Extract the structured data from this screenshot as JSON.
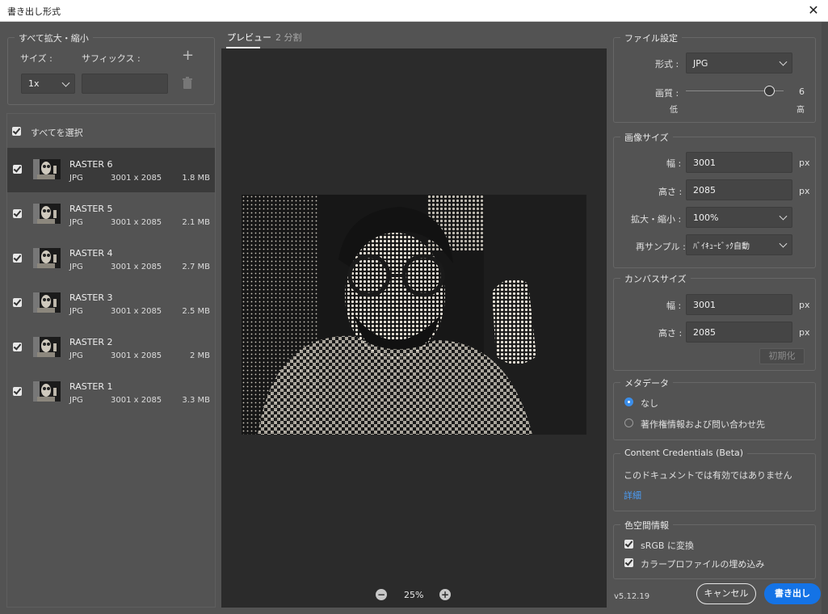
{
  "window": {
    "title": "書き出し形式"
  },
  "scale_group": {
    "legend": "すべて拡大・縮小",
    "size_label": "サイズ :",
    "suffix_label": "サフィックス :",
    "size_value": "1x",
    "suffix_value": ""
  },
  "assets": {
    "select_all_label": "すべてを選択",
    "items": [
      {
        "name": "RASTER 6",
        "format": "JPG",
        "dimensions": "3001 x 2085",
        "size": "1.8 MB",
        "selected": true
      },
      {
        "name": "RASTER 5",
        "format": "JPG",
        "dimensions": "3001 x 2085",
        "size": "2.1 MB",
        "selected": false
      },
      {
        "name": "RASTER 4",
        "format": "JPG",
        "dimensions": "3001 x 2085",
        "size": "2.7 MB",
        "selected": false
      },
      {
        "name": "RASTER 3",
        "format": "JPG",
        "dimensions": "3001 x 2085",
        "size": "2.5 MB",
        "selected": false
      },
      {
        "name": "RASTER 2",
        "format": "JPG",
        "dimensions": "3001 x 2085",
        "size": "2 MB",
        "selected": false
      },
      {
        "name": "RASTER 1",
        "format": "JPG",
        "dimensions": "3001 x 2085",
        "size": "3.3 MB",
        "selected": false
      }
    ]
  },
  "preview": {
    "tabs": [
      {
        "label": "プレビュー",
        "active": true
      },
      {
        "label": "2 分割",
        "active": false
      }
    ],
    "zoom": "25%"
  },
  "file_settings": {
    "legend": "ファイル設定",
    "format_label": "形式 :",
    "format_value": "JPG",
    "quality_label": "画質 :",
    "quality_value": "6",
    "quality_fraction": 0.86,
    "quality_low": "低",
    "quality_high": "高"
  },
  "image_size": {
    "legend": "画像サイズ",
    "width_label": "幅 :",
    "width_value": "3001",
    "height_label": "高さ :",
    "height_value": "2085",
    "unit": "px",
    "scale_label": "拡大・縮小 :",
    "scale_value": "100%",
    "resample_label": "再サンプル :",
    "resample_value": "ﾊﾞｲｷｭｰﾋﾞｯｸ自動"
  },
  "canvas_size": {
    "legend": "カンバスサイズ",
    "width_label": "幅 :",
    "width_value": "3001",
    "height_label": "高さ :",
    "height_value": "2085",
    "unit": "px",
    "reset_label": "初期化"
  },
  "metadata": {
    "legend": "メタデータ",
    "option_none": "なし",
    "option_copyright": "著作権情報および問い合わせ先"
  },
  "content_credentials": {
    "legend": "Content Credentials (Beta)",
    "message": "このドキュメントでは有効ではありません",
    "link": "詳細"
  },
  "color_space": {
    "legend": "色空間情報",
    "convert_srgb": "sRGB に変換",
    "embed_profile": "カラープロファイルの埋め込み"
  },
  "footer": {
    "version": "v5.12.19",
    "cancel": "キャンセル",
    "export": "書き出し"
  },
  "colors": {
    "accent": "#1473e6",
    "link": "#4b9cf5",
    "panel": "#535353",
    "preview_bg": "#2b2b2b"
  }
}
